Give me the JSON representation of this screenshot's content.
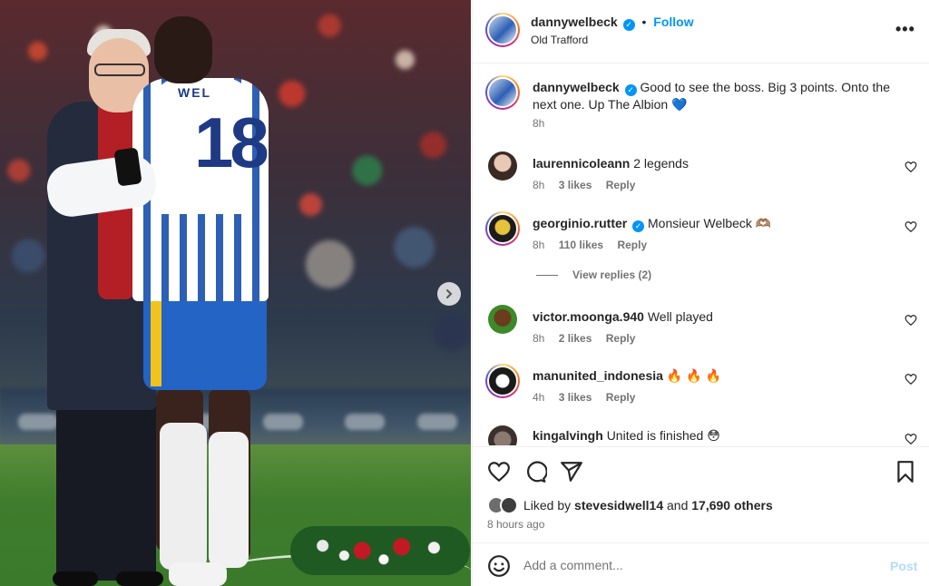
{
  "post": {
    "username": "dannywelbeck",
    "follow_label": "Follow",
    "separator": "•",
    "location": "Old Trafford",
    "more_label": "•••",
    "jersey_number": "18",
    "jersey_name": "WEL",
    "caption": {
      "username": "dannywelbeck",
      "text": "Good to see the boss. Big 3 points. Onto the next one. Up The Albion 💙",
      "time": "8h"
    }
  },
  "comments": [
    {
      "username": "laurennicoleann",
      "text": "2 legends",
      "time": "8h",
      "likes": "3 likes",
      "reply": "Reply"
    },
    {
      "username": "georginio.rutter",
      "verified": true,
      "text": "Monsieur Welbeck 🫶🏽",
      "time": "8h",
      "likes": "110 likes",
      "reply": "Reply"
    },
    {
      "username": "victor.moonga.940",
      "text": "Well played",
      "time": "8h",
      "likes": "2 likes",
      "reply": "Reply"
    },
    {
      "username": "manunited_indonesia",
      "text": "🔥 🔥 🔥",
      "time": "4h",
      "likes": "3 likes",
      "reply": "Reply"
    },
    {
      "username": "kingalvingh",
      "text": "United is finished 😳",
      "time": "",
      "likes": "",
      "reply": ""
    }
  ],
  "view_replies": "View replies (2)",
  "likes": {
    "prefix": "Liked by ",
    "user": "stevesidwell14",
    "middle": " and ",
    "count": "17,690 others"
  },
  "time_ago": "8 hours ago",
  "comment_box": {
    "placeholder": "Add a comment...",
    "post_label": "Post"
  },
  "colors": {
    "accent": "#0095f6",
    "text": "#262626",
    "muted": "#737373",
    "post_disabled": "#b3dbff"
  },
  "icons": [
    "verified-icon",
    "heart-icon",
    "comment-icon",
    "share-icon",
    "bookmark-icon",
    "emoji-icon",
    "chevron-right-icon",
    "more-icon"
  ]
}
